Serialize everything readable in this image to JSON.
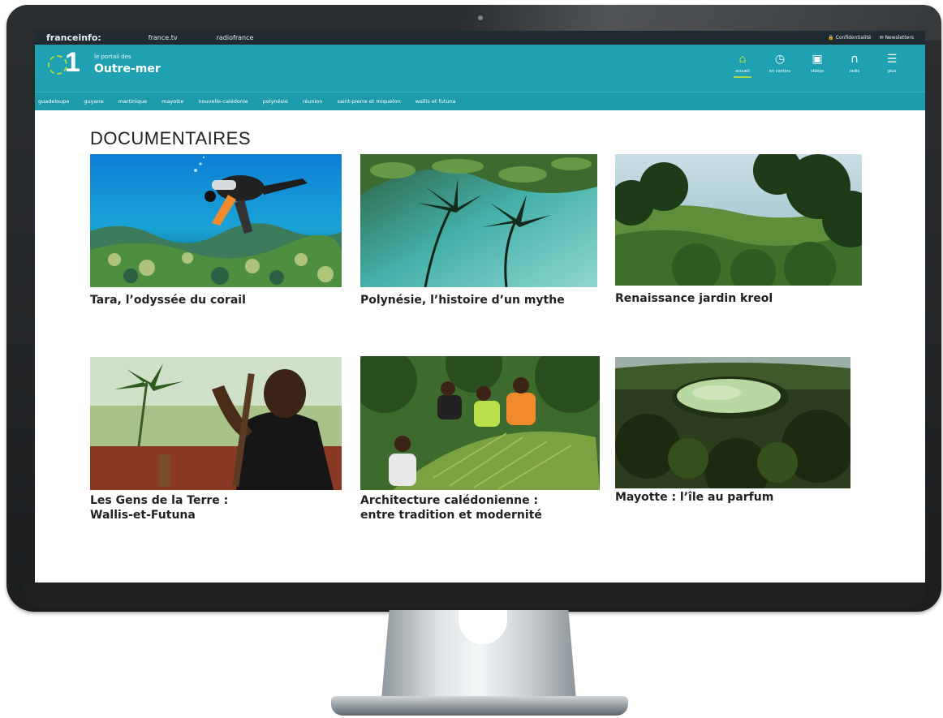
{
  "topbar": {
    "brand": "franceinfo:",
    "links": [
      "france.tv",
      "radiofrance"
    ],
    "utilities": [
      "Confidentialité",
      "Newsletters"
    ]
  },
  "header": {
    "logo_number": "1",
    "portal_subtitle": "le portail des",
    "portal_title": "Outre-mer",
    "nav": [
      {
        "label": "accueil",
        "icon": "home-icon",
        "active": true
      },
      {
        "label": "en continu",
        "icon": "clock-icon",
        "active": false
      },
      {
        "label": "vidéos",
        "icon": "video-icon",
        "active": false
      },
      {
        "label": "radio",
        "icon": "headphones-icon",
        "active": false
      },
      {
        "label": "plus",
        "icon": "menu-icon",
        "active": false
      }
    ]
  },
  "territories": [
    "guadeloupe",
    "guyane",
    "martinique",
    "mayotte",
    "nouvelle-calédonie",
    "polynésie",
    "réunion",
    "saint-pierre et miquelon",
    "wallis et futuna"
  ],
  "section_title": "DOCUMENTAIRES",
  "documentaries": [
    {
      "title_line1": "Tara, l’odyssée du corail",
      "title_line2": ""
    },
    {
      "title_line1": "Polynésie, l’histoire d’un mythe",
      "title_line2": ""
    },
    {
      "title_line1": "Renaissance jardin kreol",
      "title_line2": ""
    },
    {
      "title_line1": "Les Gens de la Terre :",
      "title_line2": "Wallis-et-Futuna"
    },
    {
      "title_line1": "Architecture calédonienne :",
      "title_line2": "entre tradition et modernité"
    },
    {
      "title_line1": "Mayotte : l’île au parfum",
      "title_line2": ""
    }
  ],
  "colors": {
    "header_teal": "#20a0b3",
    "accent_green": "#a9d84a",
    "topbar_dark": "#1f2a33"
  }
}
